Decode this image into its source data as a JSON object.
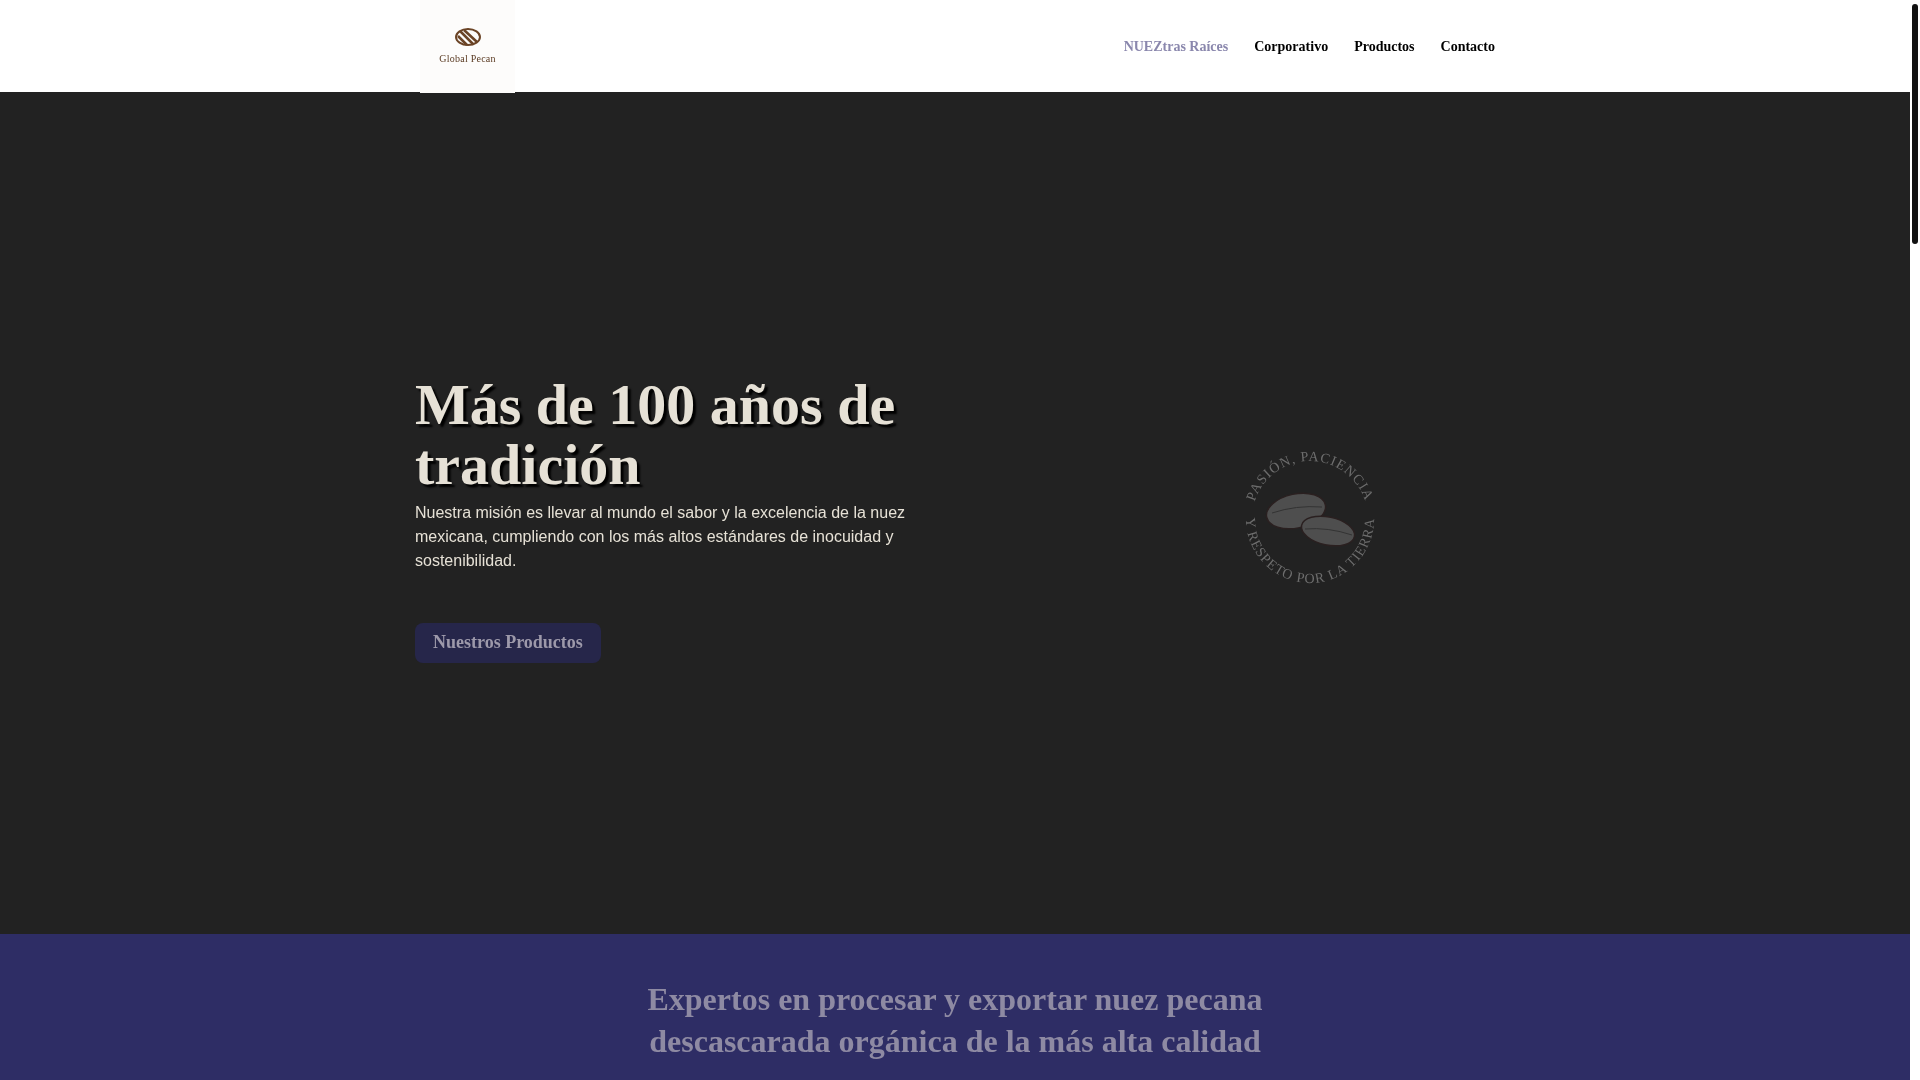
{
  "header": {
    "logo_text": "Global Pecan",
    "nav": [
      {
        "label": "NUEZtras Raíces",
        "selected": true
      },
      {
        "label": "Corporativo",
        "selected": false
      },
      {
        "label": "Productos",
        "selected": false
      },
      {
        "label": "Contacto",
        "selected": false
      }
    ]
  },
  "hero": {
    "title": "Más de 100 años de tradición",
    "text": "Nuestra misión es llevar al mundo el sabor y la excelencia de la nuez mexicana, cumpliendo con los más altos estándares de inocuidad y sostenibilidad.",
    "button": "Nuestros Productos",
    "badge": {
      "top_text": "PASIÓN, PACIENCIA",
      "bottom_text": "Y RESPETO POR LA TIERRA"
    }
  },
  "band": {
    "heading": "Expertos en procesar y exportar nuez pecana descascarada orgánica de la más alta calidad"
  }
}
